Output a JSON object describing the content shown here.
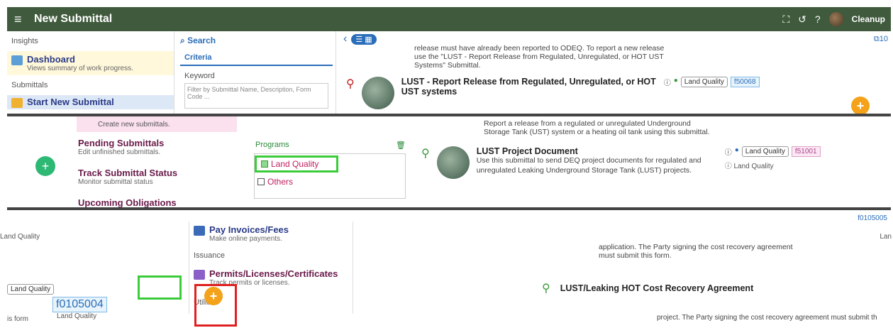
{
  "app": {
    "title": "New Submittal",
    "user": "Cleanup"
  },
  "left": {
    "insights_label": "Insights",
    "dashboard": {
      "title": "Dashboard",
      "sub": "Views summary of work progress."
    },
    "submittals_label": "Submittals",
    "start_new": "Start New Submittal",
    "start_new_sub": "Create new submittals.",
    "pending": {
      "title": "Pending Submittals",
      "sub": "Edit unfinished submittals."
    },
    "track": {
      "title": "Track Submittal Status",
      "sub": "Monitor submittal status"
    },
    "upcoming": {
      "title": "Upcoming Obligations"
    }
  },
  "search": {
    "tab": "Search",
    "criteria": "Criteria",
    "keyword_label": "Keyword",
    "keyword_placeholder": "Filter by Submittal Name, Description, Form Code ..."
  },
  "programs": {
    "label": "Programs",
    "items": [
      {
        "label": "Land Quality",
        "checked": true
      },
      {
        "label": "Others",
        "checked": false
      }
    ]
  },
  "results": {
    "count": "10",
    "top_desc": "release must have already been reported to ODEQ. To report a new release use the \"LUST - Report Release from Regulated, Unregulated, or HOT UST Systems\" Submittal.",
    "cards": [
      {
        "title": "LUST - Report Release from Regulated, Unregulated, or HOT UST systems",
        "desc": "Report a release from a regulated or unregulated Underground Storage Tank (UST) system or a heating oil tank using this submittal.",
        "program": "Land Quality",
        "code": "f50068",
        "sub_program": "Land Quality"
      },
      {
        "title": "LUST Project Document",
        "desc": "Use this submittal to send DEQ project documents for regulated and unregulated Leaking Underground Storage Tank (LUST) projects.",
        "program": "Land Quality",
        "code": "f51001",
        "sub_program": "Land Quality"
      }
    ],
    "band3_desc": "application. The Party signing the cost recovery agreement must submit this form.",
    "band3_title": "LUST/Leaking HOT Cost Recovery Agreement",
    "band3_bottom": "project. The Party signing the cost recovery agreement must submit th",
    "code_right": "f0105005",
    "code_left": "f0105004",
    "land_quality": "Land Quality",
    "lan": "Lan"
  },
  "lower": {
    "pay": "Pay Invoices/Fees",
    "pay_sub": "Make online payments.",
    "issuance": "Issuance",
    "permits": "Permits/Licenses/Certificates",
    "permits_sub": "Track permits or licenses.",
    "utilities": "Utilities",
    "is_form": "is form",
    "land_quality_tag": "Land Quality"
  }
}
